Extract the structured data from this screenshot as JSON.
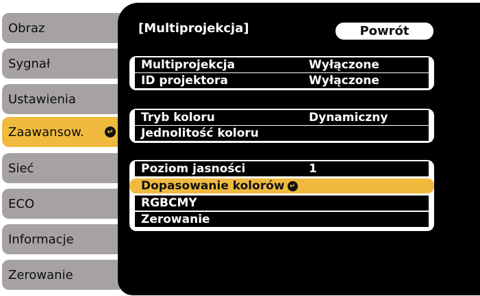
{
  "sidebar": {
    "items": [
      {
        "label": "Obraz"
      },
      {
        "label": "Sygnał"
      },
      {
        "label": "Ustawienia"
      },
      {
        "label": "Zaawansow."
      },
      {
        "label": "Sieć"
      },
      {
        "label": "ECO"
      },
      {
        "label": "Informacje"
      },
      {
        "label": "Zerowanie"
      }
    ],
    "active_index": 3
  },
  "main": {
    "title": "[Multiprojekcja]",
    "back_label": "Powrót",
    "groups": [
      {
        "rows": [
          {
            "label": "Multiprojekcja",
            "value": "Wyłączone"
          },
          {
            "label": "ID projektora",
            "value": "Wyłączone"
          }
        ]
      },
      {
        "rows": [
          {
            "label": "Tryb koloru",
            "value": "Dynamiczny"
          },
          {
            "label": "Jednolitość koloru",
            "value": ""
          }
        ]
      },
      {
        "rows": [
          {
            "label": "Poziom jasności",
            "value": "1"
          },
          {
            "label": "Dopasowanie kolorów",
            "value": ""
          },
          {
            "label": "RGBCMY",
            "value": ""
          },
          {
            "label": "Zerowanie",
            "value": ""
          }
        ]
      }
    ]
  },
  "colors": {
    "tab_bg": "#a6a2a2",
    "active_bg": "#f0ba3e",
    "panel_bg": "#000000"
  },
  "icons": {
    "enter": "enter-arrow-icon"
  }
}
